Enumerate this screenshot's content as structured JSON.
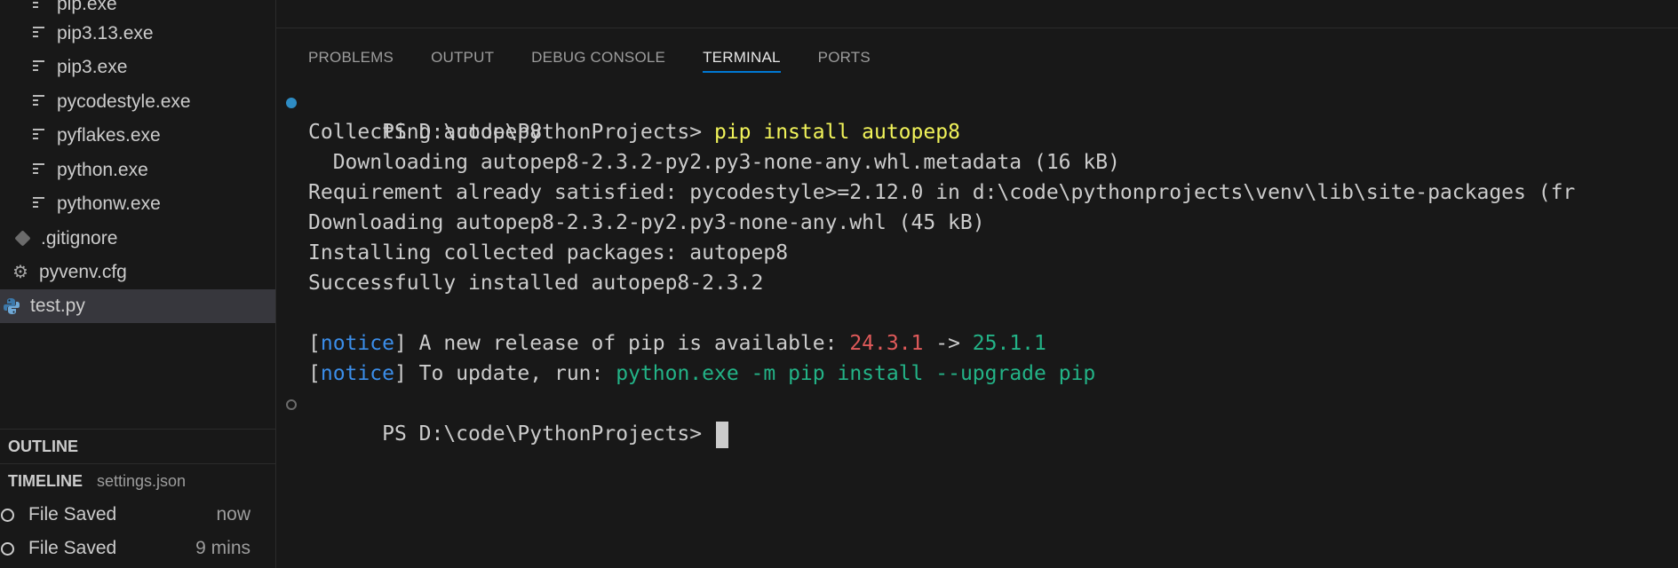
{
  "explorer": {
    "items": [
      {
        "label": "pip.exe",
        "icon": "file-lines-icon"
      },
      {
        "label": "pip3.13.exe",
        "icon": "file-lines-icon"
      },
      {
        "label": "pip3.exe",
        "icon": "file-lines-icon"
      },
      {
        "label": "pycodestyle.exe",
        "icon": "file-lines-icon"
      },
      {
        "label": "pyflakes.exe",
        "icon": "file-lines-icon"
      },
      {
        "label": "python.exe",
        "icon": "file-lines-icon"
      },
      {
        "label": "pythonw.exe",
        "icon": "file-lines-icon"
      },
      {
        "label": ".gitignore",
        "icon": "git-icon"
      },
      {
        "label": "pyvenv.cfg",
        "icon": "gear-icon"
      },
      {
        "label": "test.py",
        "icon": "python-icon",
        "selected": true
      }
    ]
  },
  "outline": {
    "title": "OUTLINE"
  },
  "timeline": {
    "title": "TIMELINE",
    "file": "settings.json",
    "entries": [
      {
        "label": "File Saved",
        "time": "now"
      },
      {
        "label": "File Saved",
        "time": "9 mins"
      }
    ]
  },
  "panel": {
    "tabs": [
      "PROBLEMS",
      "OUTPUT",
      "DEBUG CONSOLE",
      "TERMINAL",
      "PORTS"
    ],
    "active_tab": "TERMINAL"
  },
  "terminal": {
    "prompt": "PS D:\\code\\PythonProjects> ",
    "command": "pip install autopep8",
    "lines": [
      "Collecting autopep8",
      "  Downloading autopep8-2.3.2-py2.py3-none-any.whl.metadata (16 kB)",
      "Requirement already satisfied: pycodestyle>=2.12.0 in d:\\code\\pythonprojects\\venv\\lib\\site-packages (fr",
      "Downloading autopep8-2.3.2-py2.py3-none-any.whl (45 kB)",
      "Installing collected packages: autopep8",
      "Successfully installed autopep8-2.3.2"
    ],
    "notice1": {
      "open": "[",
      "tag": "notice",
      "close": "] ",
      "text": "A new release of pip is available: ",
      "old_version": "24.3.1",
      "arrow": " -> ",
      "new_version": "25.1.1"
    },
    "notice2": {
      "open": "[",
      "tag": "notice",
      "close": "] ",
      "text": "To update, run: ",
      "command": "python.exe -m pip install --upgrade pip"
    },
    "final_prompt": "PS D:\\code\\PythonProjects> "
  },
  "colors": {
    "accent": "#0078d4",
    "command": "#f1f35a",
    "notice": "#3b8eea",
    "old_version": "#e05a5a",
    "new_version": "#23b387"
  }
}
